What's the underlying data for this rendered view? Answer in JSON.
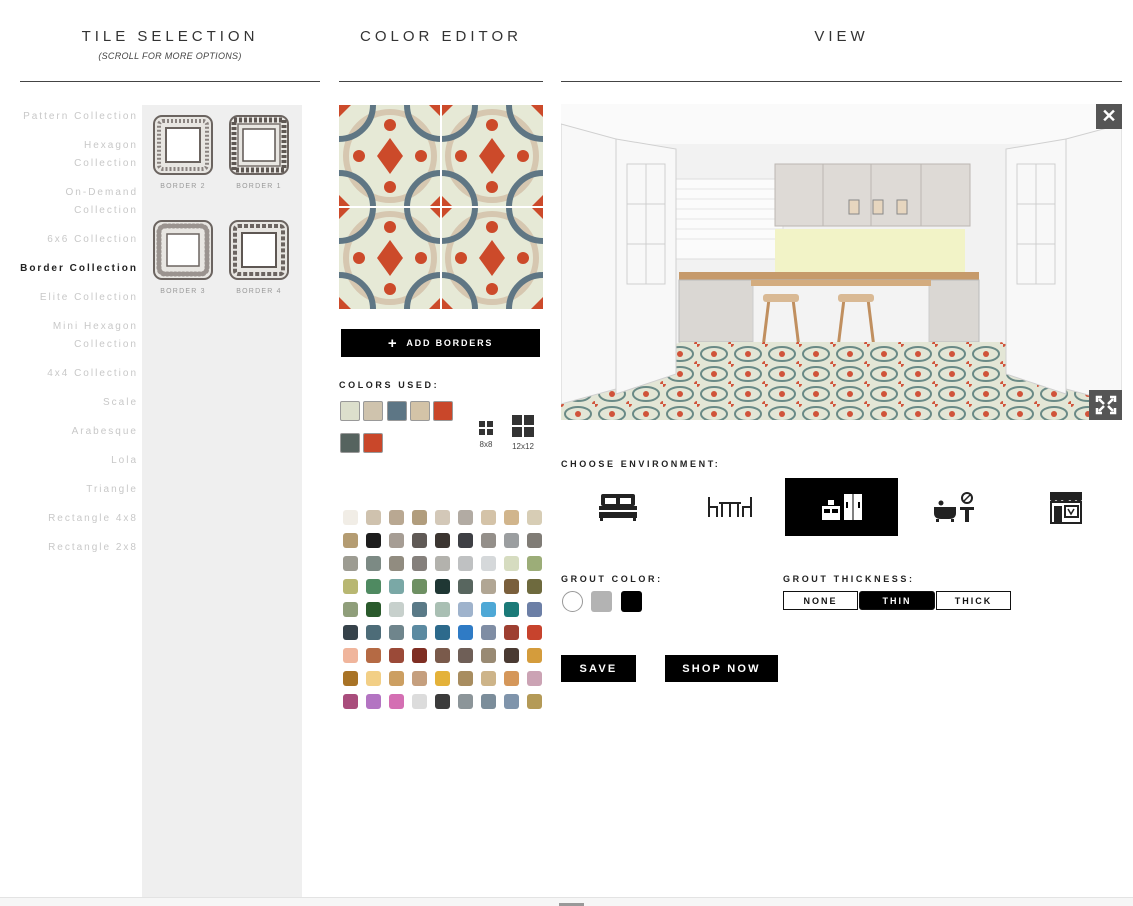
{
  "headings": {
    "tile_selection": "TILE SELECTION",
    "tile_selection_sub": "(SCROLL FOR MORE OPTIONS)",
    "color_editor": "COLOR EDITOR",
    "view": "VIEW"
  },
  "collections": [
    {
      "label": "Pattern Collection",
      "active": false
    },
    {
      "label": "Hexagon Collection",
      "active": false
    },
    {
      "label": "On-Demand Collection",
      "active": false
    },
    {
      "label": "6x6 Collection",
      "active": false
    },
    {
      "label": "Border Collection",
      "active": true
    },
    {
      "label": "Elite Collection",
      "active": false
    },
    {
      "label": "Mini Hexagon Collection",
      "active": false
    },
    {
      "label": "4x4 Collection",
      "active": false
    },
    {
      "label": "Scale",
      "active": false
    },
    {
      "label": "Arabesque",
      "active": false
    },
    {
      "label": "Lola",
      "active": false
    },
    {
      "label": "Triangle",
      "active": false
    },
    {
      "label": "Rectangle 4x8",
      "active": false
    },
    {
      "label": "Rectangle 2x8",
      "active": false
    }
  ],
  "tiles": [
    {
      "label": "BORDER 2",
      "icon": "border-tile-icon"
    },
    {
      "label": "BORDER 1",
      "icon": "greek-key-border-tile-icon"
    },
    {
      "label": "BORDER 3",
      "icon": "beaded-border-tile-icon"
    },
    {
      "label": "BORDER 4",
      "icon": "ornate-border-tile-icon"
    }
  ],
  "color_editor": {
    "add_borders": "ADD BORDERS",
    "add_icon": "+",
    "colors_used_label": "COLORS USED:",
    "colors_used": [
      "#dcdfcc",
      "#cfc3ad",
      "#5d7685",
      "#d3c3a7",
      "#c9472a",
      "#56635f",
      "#c9472a"
    ],
    "grid_options": [
      "8x8",
      "12x12"
    ],
    "palette": [
      "#f1ede6",
      "#cfc2ae",
      "#b9a892",
      "#b19d7d",
      "#d3c8b8",
      "#b2aba3",
      "#d4c3a8",
      "#d1b58c",
      "#d7cdb5",
      "#b49c72",
      "#1d1d1d",
      "#a69d94",
      "#605a56",
      "#3b3531",
      "#3e3f44",
      "#948f8a",
      "#9b9ea0",
      "#807c76",
      "#9d9c92",
      "#7c8a84",
      "#918c80",
      "#85807c",
      "#b3b2ad",
      "#bfc1c2",
      "#d5d8da",
      "#d6dcc0",
      "#9cad78",
      "#b8b772",
      "#4f8a61",
      "#7aa8a6",
      "#6e9063",
      "#1f3734",
      "#58665f",
      "#b1a694",
      "#7a5f3c",
      "#6e6a3e",
      "#8f9e7a",
      "#2a5a2c",
      "#c7d0cc",
      "#5a7a87",
      "#a9bfb3",
      "#9fb3cc",
      "#4ea8d6",
      "#1b7a78",
      "#6c7fa6",
      "#36424a",
      "#4d6c78",
      "#6f858c",
      "#5b8aa1",
      "#2d6a8c",
      "#2f7bc5",
      "#7f8da4",
      "#9e3f31",
      "#c7432d",
      "#f0b59c",
      "#b56a44",
      "#9b4a38",
      "#7f2e23",
      "#7a5a4b",
      "#6f5f57",
      "#998a73",
      "#4a3a32",
      "#d49c3c",
      "#a87326",
      "#f2cf86",
      "#cc9f62",
      "#c59f7e",
      "#e4b23a",
      "#a88d60",
      "#cdb489",
      "#d5975a",
      "#cba3b4",
      "#a94d7c",
      "#b374c2",
      "#d46fb3",
      "#dcdcdc",
      "#3b3b3b",
      "#8c9599",
      "#7b8d9a",
      "#7f94ab",
      "#b49a57"
    ]
  },
  "view": {
    "close_icon": "close-icon",
    "expand_icon": "expand-icon",
    "choose_environment_label": "CHOOSE ENVIRONMENT:",
    "environments": [
      {
        "icon": "bedroom-icon",
        "active": false
      },
      {
        "icon": "dining-icon",
        "active": false
      },
      {
        "icon": "kitchen-icon",
        "active": true
      },
      {
        "icon": "bathroom-icon",
        "active": false
      },
      {
        "icon": "storefront-icon",
        "active": false
      }
    ],
    "grout_color_label": "GROUT COLOR:",
    "grout_colors": [
      "#ffffff",
      "#b3b3b3",
      "#000000"
    ],
    "grout_thickness_label": "GROUT THICKNESS:",
    "grout_thickness": [
      {
        "label": "NONE",
        "active": false
      },
      {
        "label": "THIN",
        "active": true
      },
      {
        "label": "THICK",
        "active": false
      }
    ],
    "save": "SAVE",
    "shop_now": "SHOP NOW"
  }
}
